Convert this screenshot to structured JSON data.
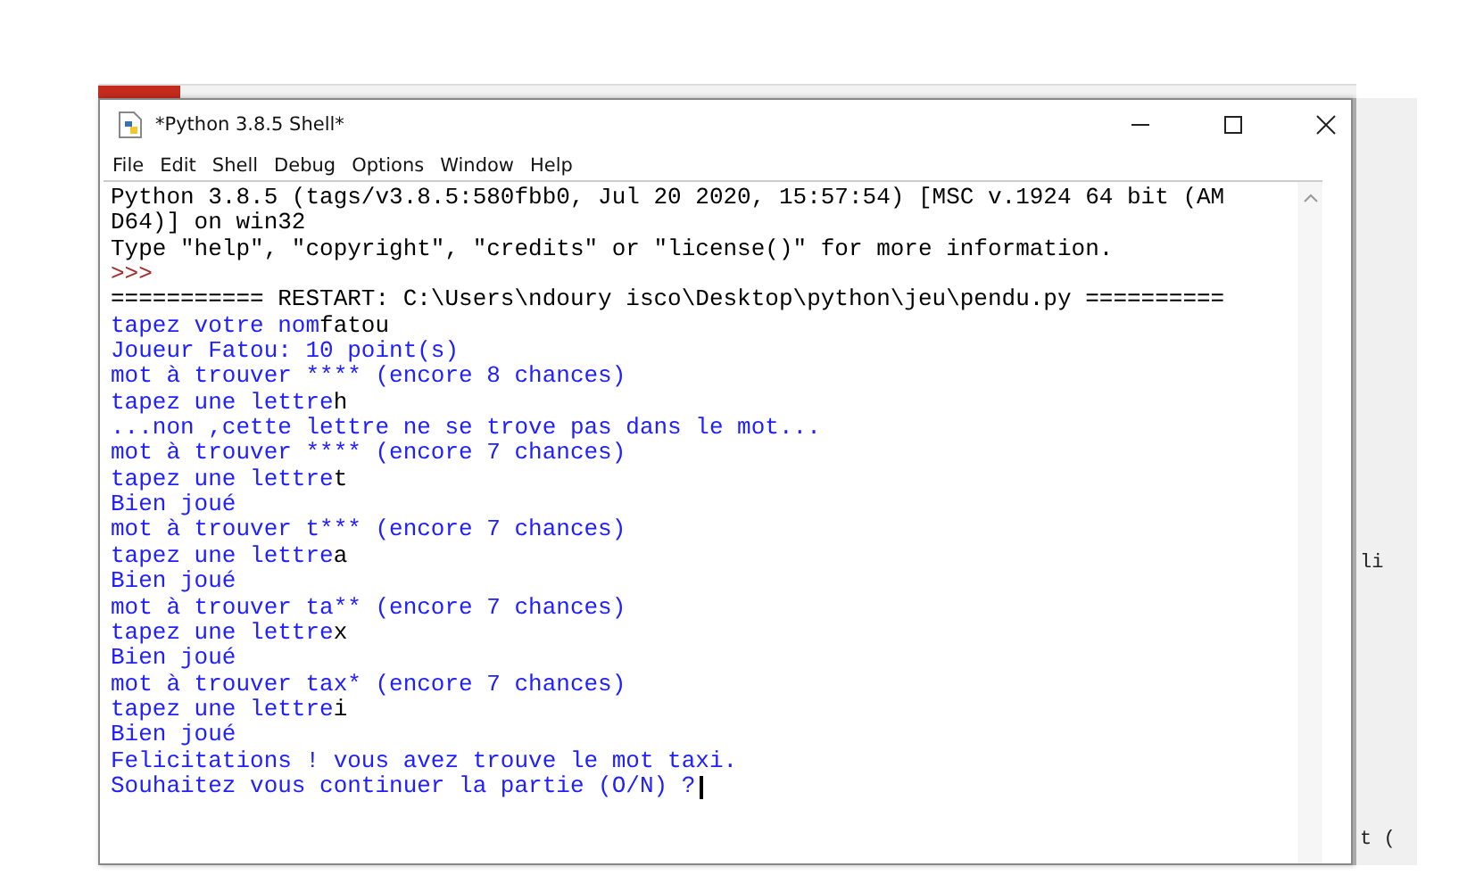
{
  "window": {
    "title": "*Python 3.8.5 Shell*"
  },
  "menu": [
    "File",
    "Edit",
    "Shell",
    "Debug",
    "Options",
    "Window",
    "Help"
  ],
  "shell_lines": [
    [
      {
        "kind": "output",
        "text": "Python 3.8.5 (tags/v3.8.5:580fbb0, Jul 20 2020, 15:57:54) [MSC v.1924 64 bit (AM"
      }
    ],
    [
      {
        "kind": "output",
        "text": "D64)] on win32"
      }
    ],
    [
      {
        "kind": "output",
        "text": "Type \"help\", \"copyright\", \"credits\" or \"license()\" for more information."
      }
    ],
    [
      {
        "kind": "prompt",
        "text": ">>>"
      }
    ],
    [
      {
        "kind": "restart",
        "text": "=========== RESTART: C:\\Users\\ndoury isco\\Desktop\\python\\jeu\\pendu.py =========="
      }
    ],
    [
      {
        "kind": "stdout",
        "text": "tapez votre nom"
      },
      {
        "kind": "input",
        "text": "fatou"
      }
    ],
    [
      {
        "kind": "stdout",
        "text": "Joueur Fatou: 10 point(s)"
      }
    ],
    [
      {
        "kind": "stdout",
        "text": "mot à trouver **** (encore 8 chances)"
      }
    ],
    [
      {
        "kind": "stdout",
        "text": "tapez une lettre"
      },
      {
        "kind": "input",
        "text": "h"
      }
    ],
    [
      {
        "kind": "stdout",
        "text": "...non ,cette lettre ne se trove pas dans le mot..."
      }
    ],
    [
      {
        "kind": "stdout",
        "text": "mot à trouver **** (encore 7 chances)"
      }
    ],
    [
      {
        "kind": "stdout",
        "text": "tapez une lettre"
      },
      {
        "kind": "input",
        "text": "t"
      }
    ],
    [
      {
        "kind": "stdout",
        "text": "Bien joué"
      }
    ],
    [
      {
        "kind": "stdout",
        "text": "mot à trouver t*** (encore 7 chances)"
      }
    ],
    [
      {
        "kind": "stdout",
        "text": "tapez une lettre"
      },
      {
        "kind": "input",
        "text": "a"
      }
    ],
    [
      {
        "kind": "stdout",
        "text": "Bien joué"
      }
    ],
    [
      {
        "kind": "stdout",
        "text": "mot à trouver ta** (encore 7 chances)"
      }
    ],
    [
      {
        "kind": "stdout",
        "text": "tapez une lettre"
      },
      {
        "kind": "input",
        "text": "x"
      }
    ],
    [
      {
        "kind": "stdout",
        "text": "Bien joué"
      }
    ],
    [
      {
        "kind": "stdout",
        "text": "mot à trouver tax* (encore 7 chances)"
      }
    ],
    [
      {
        "kind": "stdout",
        "text": "tapez une lettre"
      },
      {
        "kind": "input",
        "text": "i"
      }
    ],
    [
      {
        "kind": "stdout",
        "text": "Bien joué"
      }
    ],
    [
      {
        "kind": "stdout",
        "text": "Felicitations ! vous avez trouve le mot taxi."
      }
    ],
    [
      {
        "kind": "stdout",
        "text": "Souhaitez vous continuer la partie (O/N) ?"
      },
      {
        "kind": "cursor"
      }
    ]
  ],
  "background_window": {
    "text_1": "li",
    "text_2": "t ("
  }
}
